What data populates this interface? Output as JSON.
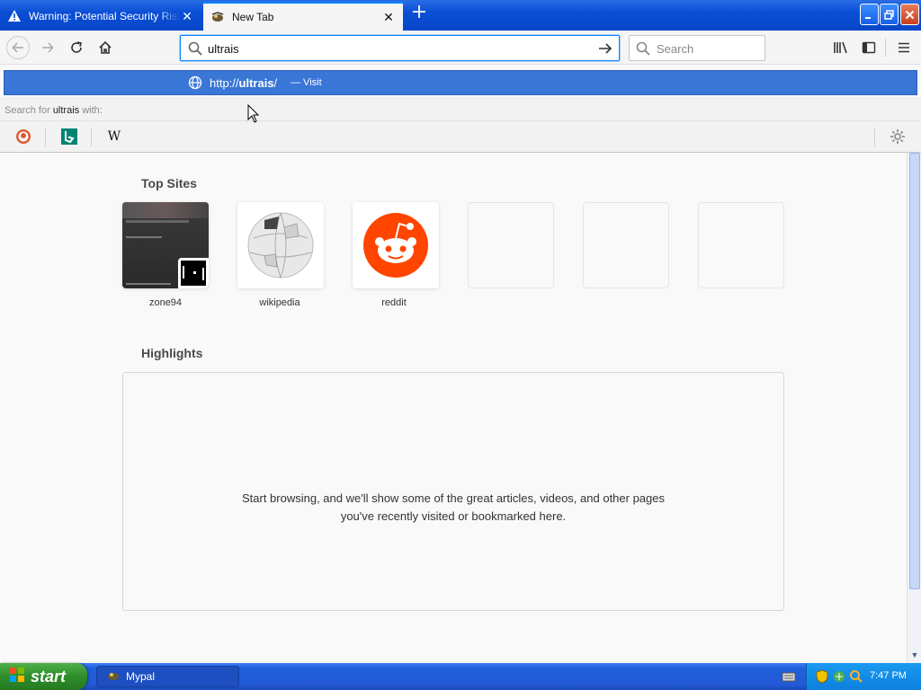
{
  "tabs": [
    {
      "label": "Warning: Potential Security Risk Ahead",
      "icon": "warning-icon",
      "active": false
    },
    {
      "label": "New Tab",
      "icon": "mypal-icon",
      "active": true
    }
  ],
  "toolbar": {
    "url_value": "ultrais",
    "search_placeholder": "Search"
  },
  "autocomplete": {
    "url_prefix": "http://",
    "url_bold": "ultrais",
    "url_suffix": "/",
    "visit_text": "— Visit",
    "search_for_prefix": "Search for ",
    "search_query": "ultrais",
    "search_for_suffix": " with:",
    "engines": [
      "duckduckgo-icon",
      "bing-icon",
      "wikipedia-icon"
    ],
    "wikipedia_glyph": "W"
  },
  "top_sites": {
    "title": "Top Sites",
    "items": [
      {
        "label": "zone94"
      },
      {
        "label": "wikipedia"
      },
      {
        "label": "reddit"
      }
    ]
  },
  "highlights": {
    "title": "Highlights",
    "message": "Start browsing, and we'll show some of the great articles, videos, and other pages you've recently visited or bookmarked here."
  },
  "taskbar": {
    "start_label": "start",
    "task_label": "Mypal",
    "clock": "7:47 PM"
  },
  "colors": {
    "accent": "#0a84ff",
    "autocomplete_highlight": "#3a76d6",
    "reddit": "#ff4500"
  }
}
